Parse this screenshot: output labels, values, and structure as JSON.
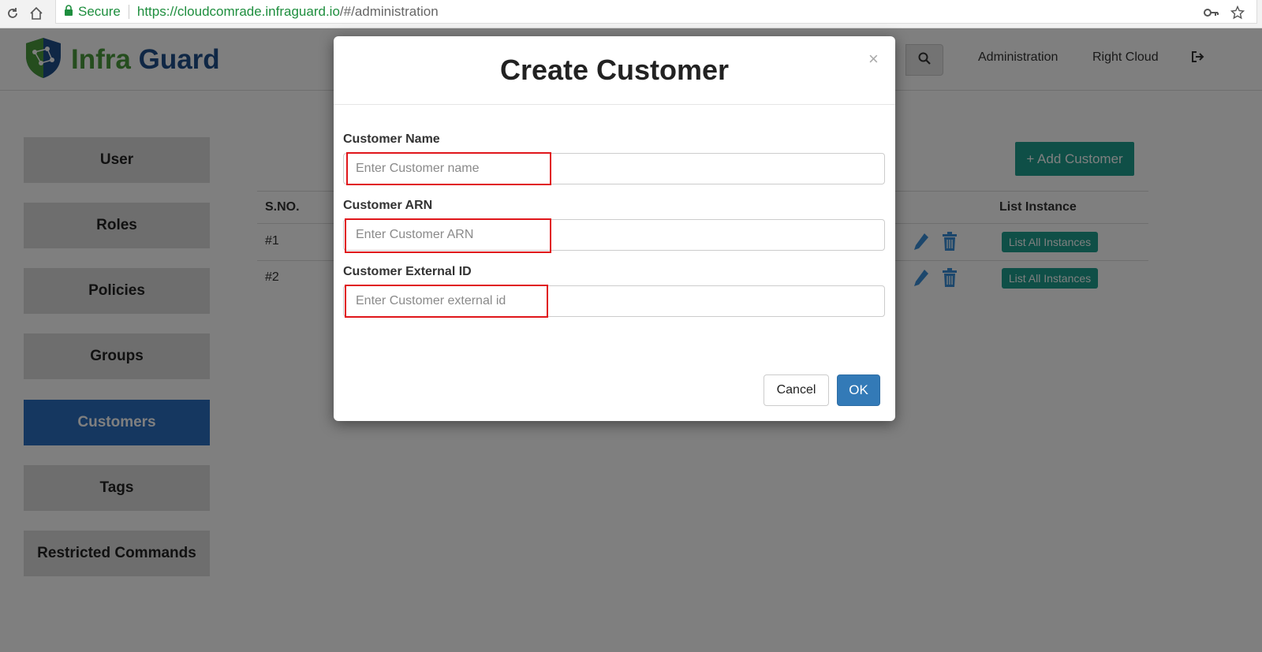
{
  "browser": {
    "secure_label": "Secure",
    "url_host": "https://cloudcomrade.infraguard.io",
    "url_path": "/#/administration"
  },
  "header": {
    "logo_part1": "Infra",
    "logo_part2": "Guard",
    "nav": [
      "Administration",
      "Right Cloud"
    ]
  },
  "sidebar": {
    "items": [
      {
        "label": "User"
      },
      {
        "label": "Roles"
      },
      {
        "label": "Policies"
      },
      {
        "label": "Groups"
      },
      {
        "label": "Customers",
        "active": true
      },
      {
        "label": "Tags"
      },
      {
        "label": "Restricted Commands"
      }
    ]
  },
  "main": {
    "add_button": "+ Add Customer",
    "columns": [
      "S.NO.",
      "List Instance"
    ],
    "rows": [
      {
        "sno": "#1",
        "action": "List All Instances"
      },
      {
        "sno": "#2",
        "action": "List All Instances"
      }
    ]
  },
  "modal": {
    "title": "Create Customer",
    "close": "×",
    "fields": [
      {
        "label": "Customer Name",
        "placeholder": "Enter Customer name"
      },
      {
        "label": "Customer ARN",
        "placeholder": "Enter Customer ARN"
      },
      {
        "label": "Customer External ID",
        "placeholder": "Enter Customer external id"
      }
    ],
    "cancel": "Cancel",
    "ok": "OK"
  },
  "colors": {
    "accent_teal": "#1e9e8e",
    "active_blue": "#2a6fc0",
    "primary_blue": "#337ab7",
    "highlight_red": "#e0161b"
  }
}
